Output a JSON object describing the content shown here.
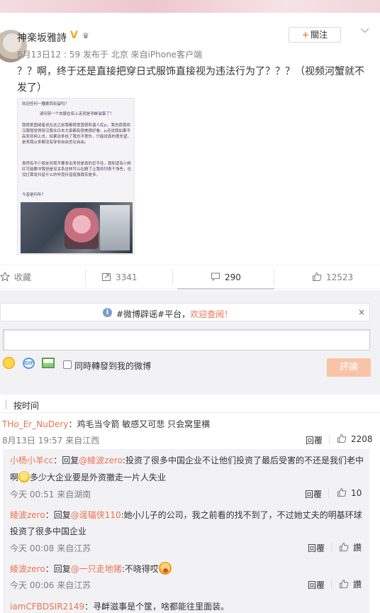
{
  "post": {
    "username": "神楽坂雅詩",
    "verified_badge": "V",
    "meta": "8月13日12 : 59 发布于 北京 來自iPhone客户端",
    "follow_label": "關注",
    "follow_plus": "+",
    "text": "？？啊，终于还是直接把穿日式服饰直接视为违法行为了？？？（视频河蟹就不发了）",
    "image_text": {
      "line1": "欢迎任何一種東西有留吗？",
      "line2": "请问穿一个衣服在街上走就是寻衅滋事了？",
      "para1": "我很爱国或者说在这之前我都很爱国很和谐人民jc，我也很喜欢汉服我觉得穿汉服去日本大家都有很美很好看。jc还说我如果不高发到网上去，如果这条挂了我也不意外，只能说真的很失望，是来我从来都没有穿衣自由言论自由。",
      "para2": "虽然有不少朋友劝我不要发出来但是真的忍不住，我知道有小粉红可能要冲我但是没关系这样可以在删了让我的列表干净些，也没打算发抖音什么的毕竟抖音挺独裁实是多。",
      "line3": "今昔是何年？"
    }
  },
  "actions": {
    "favorite": "收藏",
    "repost": "3341",
    "comment": "290",
    "like": "12523"
  },
  "comment_box": {
    "notice_prefix": "#微博辟谣#平台，",
    "notice_link": "欢迎查阅！",
    "close": "×",
    "info_icon": "i",
    "gif_label": "GIF",
    "repost_option": "同時轉發到我的微博",
    "submit": "評論"
  },
  "sort": {
    "label": "按时间"
  },
  "comments": [
    {
      "user": "THo_Er_NuDery",
      "text": "：鸡毛当令箭 敏感又可悲 只会窝里横",
      "time": "8月13日 19:57 来自江西",
      "reply": "回覆",
      "likes": "2208"
    }
  ],
  "replies": [
    {
      "user": "小杨小羊cc",
      "prefix": "：回复",
      "mention": "@綾波zero",
      "text_a": ":投资了很多中国企业不让他们投资了最后受害的不还是我们老中",
      "text_b": "啊",
      "text_c": "多少大企业要是外资撤走一片人失业",
      "time": "今天 00:51 来自湖南",
      "reply": "回覆",
      "likes": "10"
    },
    {
      "user": "綾波zero",
      "prefix": "：回复",
      "mention": "@逞辐侠110",
      "text_a": ":她小儿子的公司，我之前看的找不到了，不过她丈夫的明基环球",
      "text_b": "投资了很多中国企业",
      "time": "今天 00:08 来自江苏",
      "reply": "回覆",
      "likes": "讚"
    },
    {
      "user": "綾波zero",
      "prefix": "：回复",
      "mention": "@一只走地猪",
      "text_a": ":不晓得哎",
      "time": "今天 00:06 来自江苏",
      "reply": "回覆",
      "likes": "讚"
    },
    {
      "user": "iamCFBDSIR2149",
      "text_a": "：寻衅滋事是个筐，啥都能往里面装。"
    }
  ],
  "colors": {
    "accent": "#eb7350",
    "submit_disabled": "#f8c3a6",
    "background_gray": "#f2f2f5"
  },
  "icons": [
    "avatar",
    "verified-v-icon",
    "crown-icon",
    "chevron-down-icon",
    "star-icon",
    "repost-icon",
    "comment-icon",
    "thumbs-up-icon",
    "info-icon",
    "close-icon",
    "emoji-icon",
    "gif-icon",
    "image-icon"
  ]
}
